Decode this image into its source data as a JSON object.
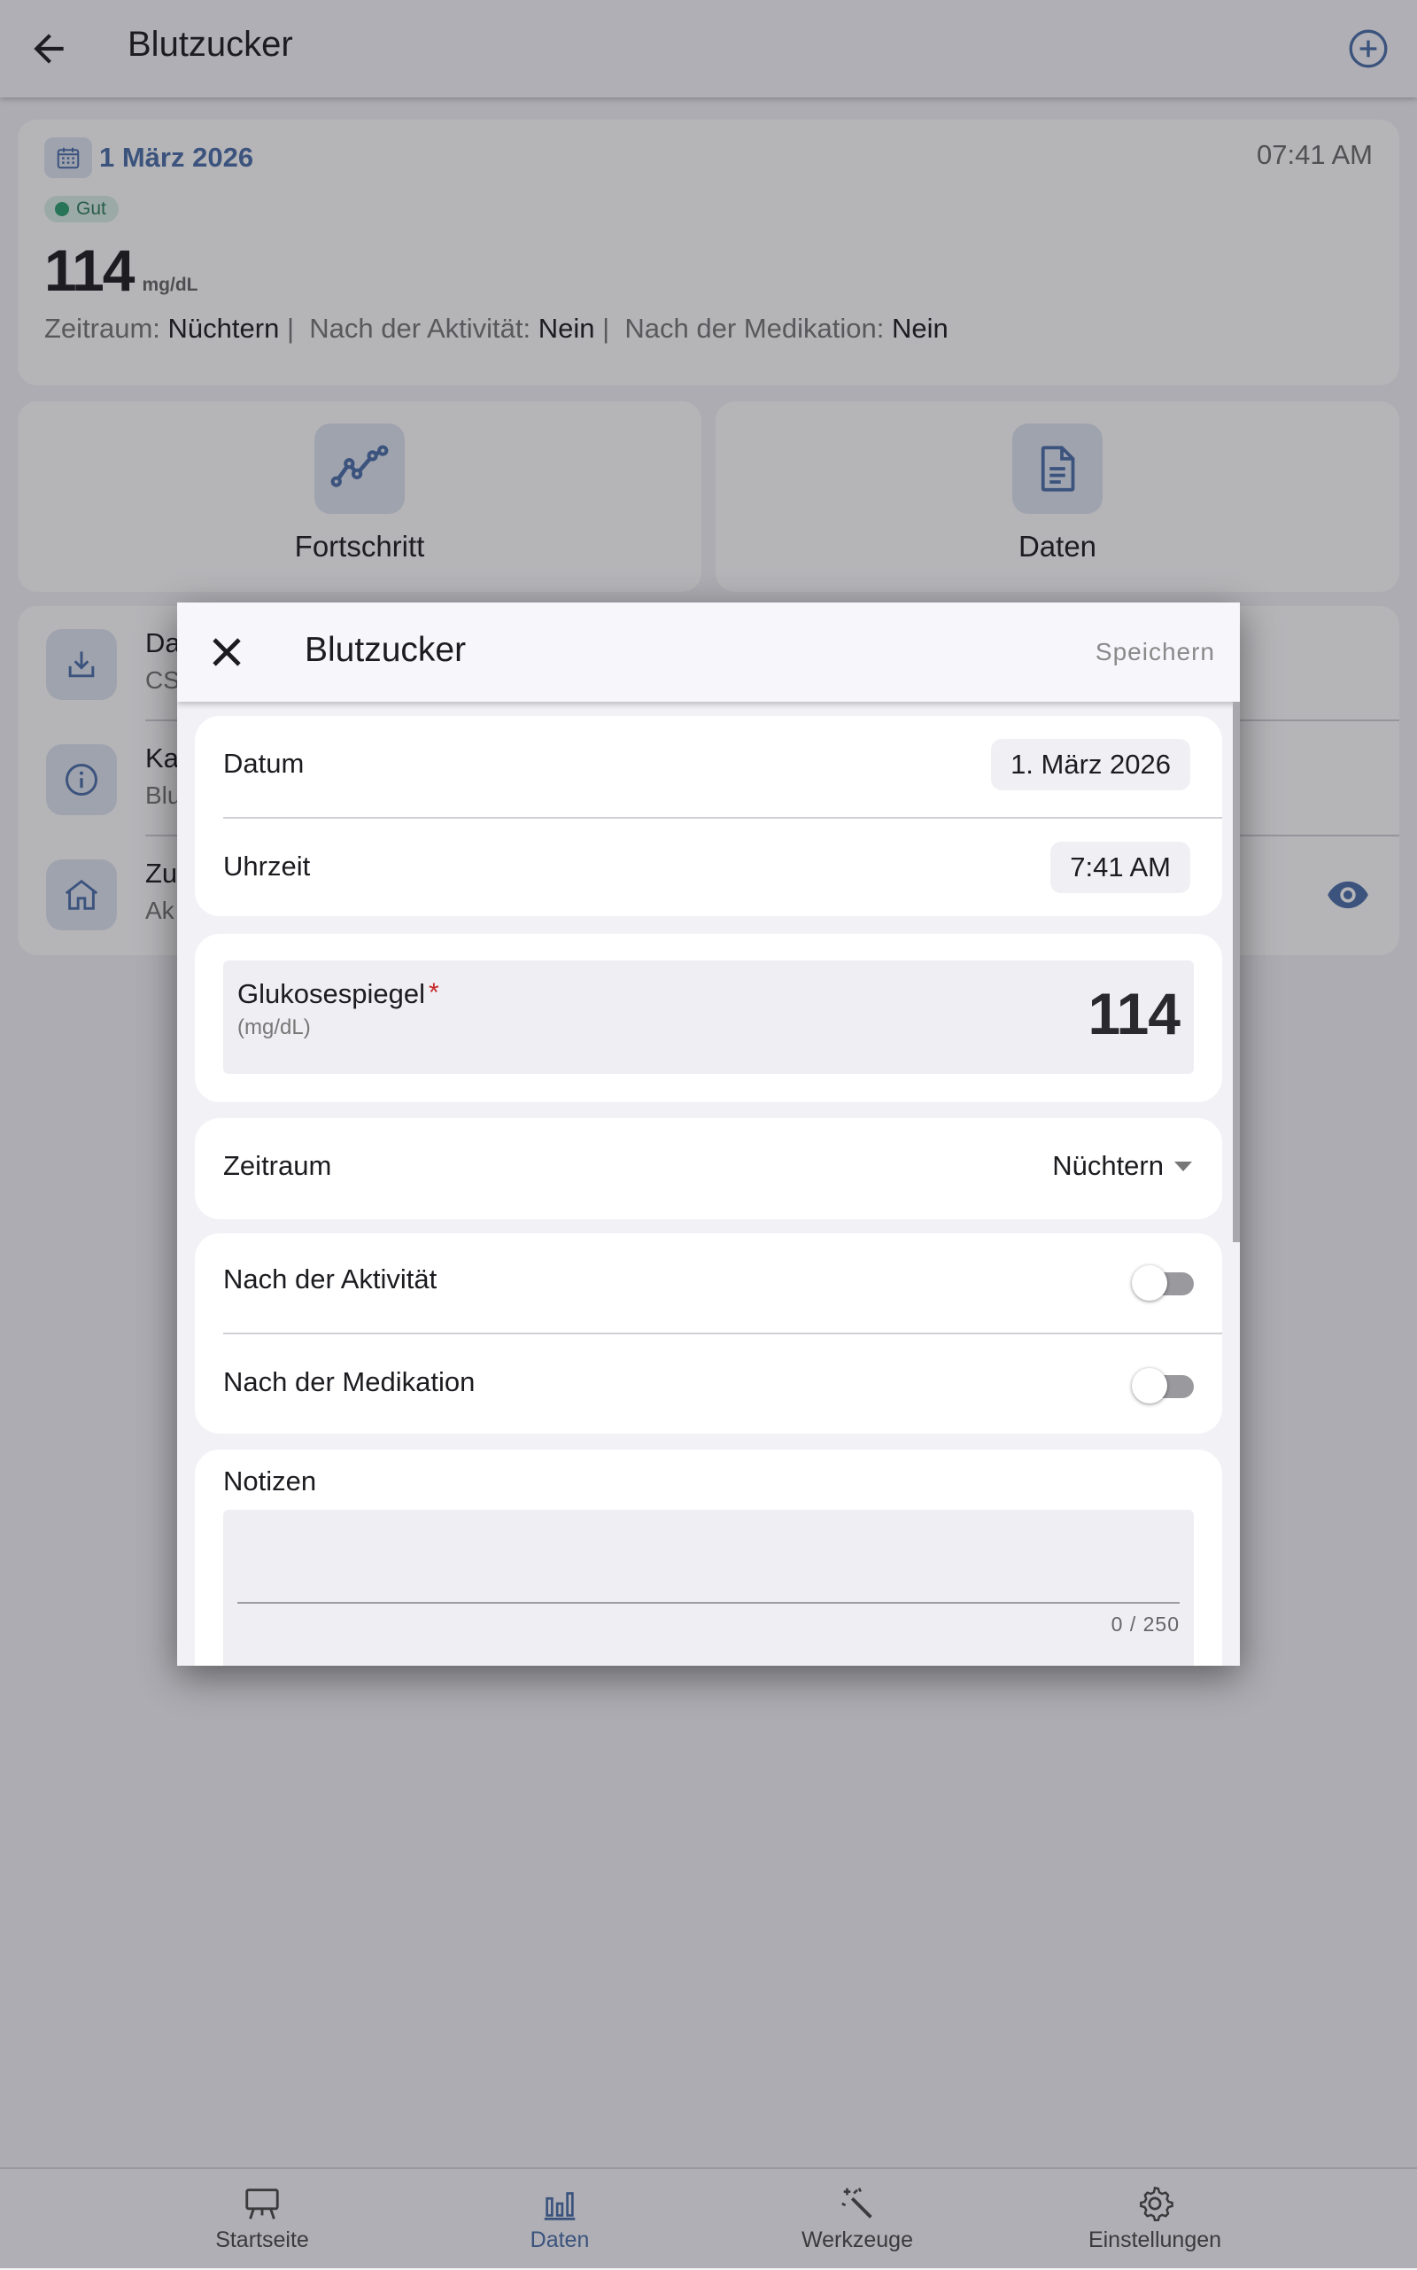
{
  "app_bar": {
    "title": "Blutzucker"
  },
  "entry": {
    "date": "1 März 2026",
    "time": "07:41 AM",
    "status": "Gut",
    "value": "114",
    "unit": "mg/dL",
    "meta": [
      {
        "label": "Zeitraum:",
        "value": "Nüchtern",
        "sep": "|"
      },
      {
        "label": "Nach der Aktivität:",
        "value": "Nein",
        "sep": "|"
      },
      {
        "label": "Nach der Medikation:",
        "value": "Nein",
        "sep": ""
      }
    ]
  },
  "tiles": [
    {
      "label": "Fortschritt",
      "icon": "line-chart-icon"
    },
    {
      "label": "Daten",
      "icon": "document-icon"
    }
  ],
  "list": [
    {
      "title": "Da",
      "subtitle": "CS",
      "icon": "download-icon"
    },
    {
      "title": "Ka",
      "subtitle": "Blu",
      "icon": "info-icon"
    },
    {
      "title": "Zu",
      "subtitle": "Ak",
      "icon": "home-icon",
      "trailing_icon": "eye-icon"
    }
  ],
  "bottom_nav": [
    {
      "label": "Startseite",
      "icon": "easel-icon",
      "active": false
    },
    {
      "label": "Daten",
      "icon": "bar-chart-icon",
      "active": true
    },
    {
      "label": "Werkzeuge",
      "icon": "magic-wand-icon",
      "active": false
    },
    {
      "label": "Einstellungen",
      "icon": "gear-icon",
      "active": false
    }
  ],
  "dialog": {
    "title": "Blutzucker",
    "save_label": "Speichern",
    "date_label": "Datum",
    "date_value": "1. März 2026",
    "time_label": "Uhrzeit",
    "time_value": "7:41 AM",
    "glucose_label": "Glukosespiegel",
    "glucose_required": "*",
    "glucose_unit": "(mg/dL)",
    "glucose_value": "114",
    "period_label": "Zeitraum",
    "period_value": "Nüchtern",
    "after_activity_label": "Nach der Aktivität",
    "after_activity_on": false,
    "after_medication_label": "Nach der Medikation",
    "after_medication_on": false,
    "notes_label": "Notizen",
    "notes_value": "",
    "notes_counter": "0 / 250"
  },
  "colors": {
    "accent": "#4a6ea8",
    "good": "#2e9e6e",
    "required": "#c62828"
  }
}
